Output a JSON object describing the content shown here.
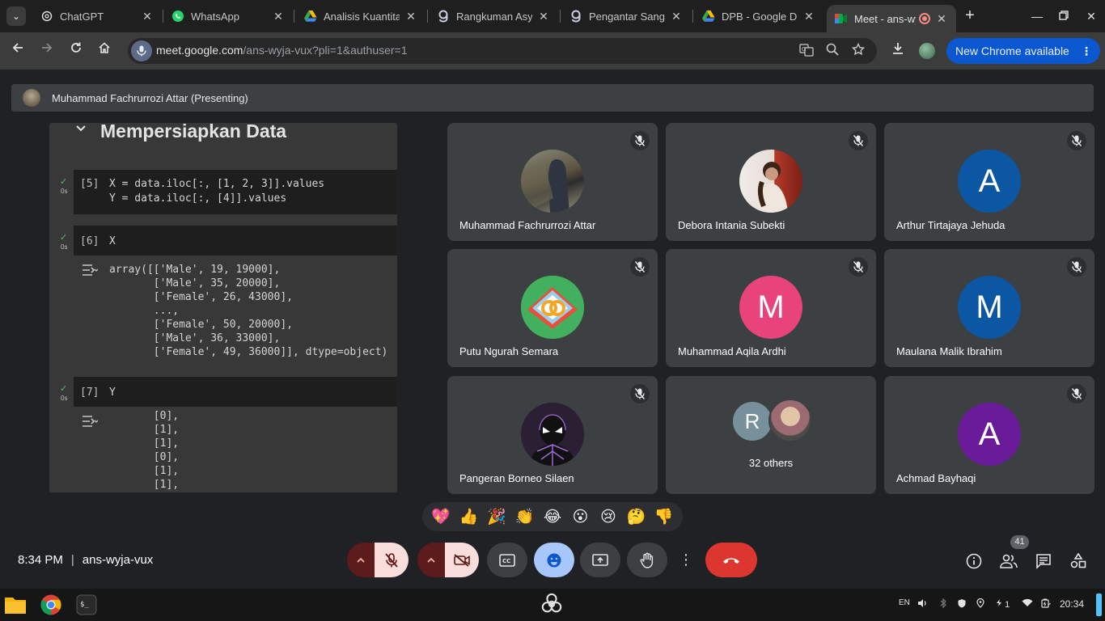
{
  "browser": {
    "tabs": [
      {
        "title": "ChatGPT",
        "icon": "chatgpt-icon"
      },
      {
        "title": "WhatsApp",
        "icon": "whatsapp-icon"
      },
      {
        "title": "Analisis Kuantitatif",
        "icon": "google-drive-icon"
      },
      {
        "title": "Rangkuman Asynchronous",
        "icon": "gamma-icon"
      },
      {
        "title": "Pengantar Sang",
        "icon": "gamma-icon"
      },
      {
        "title": "DPB - Google Drive",
        "icon": "google-drive-icon"
      },
      {
        "title": "Meet - ans-wyja-vux",
        "icon": "google-meet-icon",
        "active": true
      }
    ],
    "url_host": "meet.google.com",
    "url_path": "/ans-wyja-vux?pli=1&authuser=1",
    "update_label": "New Chrome available"
  },
  "meet": {
    "presenter_label": "Muhammad Fachrurrozi Attar (Presenting)",
    "presentation": {
      "section_title": "Mempersiapkan Data",
      "cells": [
        {
          "label": "[5]",
          "time": "0s",
          "code": [
            "X = data.iloc[:, [1, 2, 3]].values",
            "Y = data.iloc[:, [4]].values"
          ]
        },
        {
          "label": "[6]",
          "time": "0s",
          "code": [
            "X"
          ],
          "output": [
            "array([['Male', 19, 19000],",
            "       ['Male', 35, 20000],",
            "       ['Female', 26, 43000],",
            "       ...,",
            "       ['Female', 50, 20000],",
            "       ['Male', 36, 33000],",
            "       ['Female', 49, 36000]], dtype=object)"
          ]
        },
        {
          "label": "[7]",
          "time": "0s",
          "code": [
            "Y"
          ],
          "output": [
            "       [0],",
            "       [1],",
            "       [1],",
            "       [0],",
            "       [1],",
            "       [1],"
          ]
        }
      ]
    },
    "participants": [
      {
        "name": "Muhammad Fachrurrozi Attar",
        "initial": "",
        "color": "#6b6b5e"
      },
      {
        "name": "Debora Intania Subekti",
        "initial": "",
        "color": "#d9c8c0"
      },
      {
        "name": "Arthur Tirtajaya Jehuda",
        "initial": "A",
        "color": "#0b57a3"
      },
      {
        "name": "Putu Ngurah Semara",
        "initial": "",
        "color": "#3aa55c"
      },
      {
        "name": "Muhammad Aqila Ardhi",
        "initial": "M",
        "color": "#e8437b"
      },
      {
        "name": "Maulana Malik Ibrahim",
        "initial": "M",
        "color": "#0b57a3"
      },
      {
        "name": "Pangeran Borneo Silaen",
        "initial": "",
        "color": "#3a2a4a"
      },
      {
        "name": "Achmad Bayhaqi",
        "initial": "A",
        "color": "#6a1b9a"
      }
    ],
    "others": {
      "initial": "R",
      "label": "32 others"
    },
    "reactions": [
      "💖",
      "👍",
      "🎉",
      "👏",
      "😂",
      "😮",
      "😢",
      "🤔",
      "👎"
    ],
    "time": "8:34 PM",
    "meeting_code": "ans-wyja-vux",
    "people_count": "41"
  },
  "os": {
    "language": "EN",
    "notification_count": "1",
    "clock": "20:34"
  }
}
